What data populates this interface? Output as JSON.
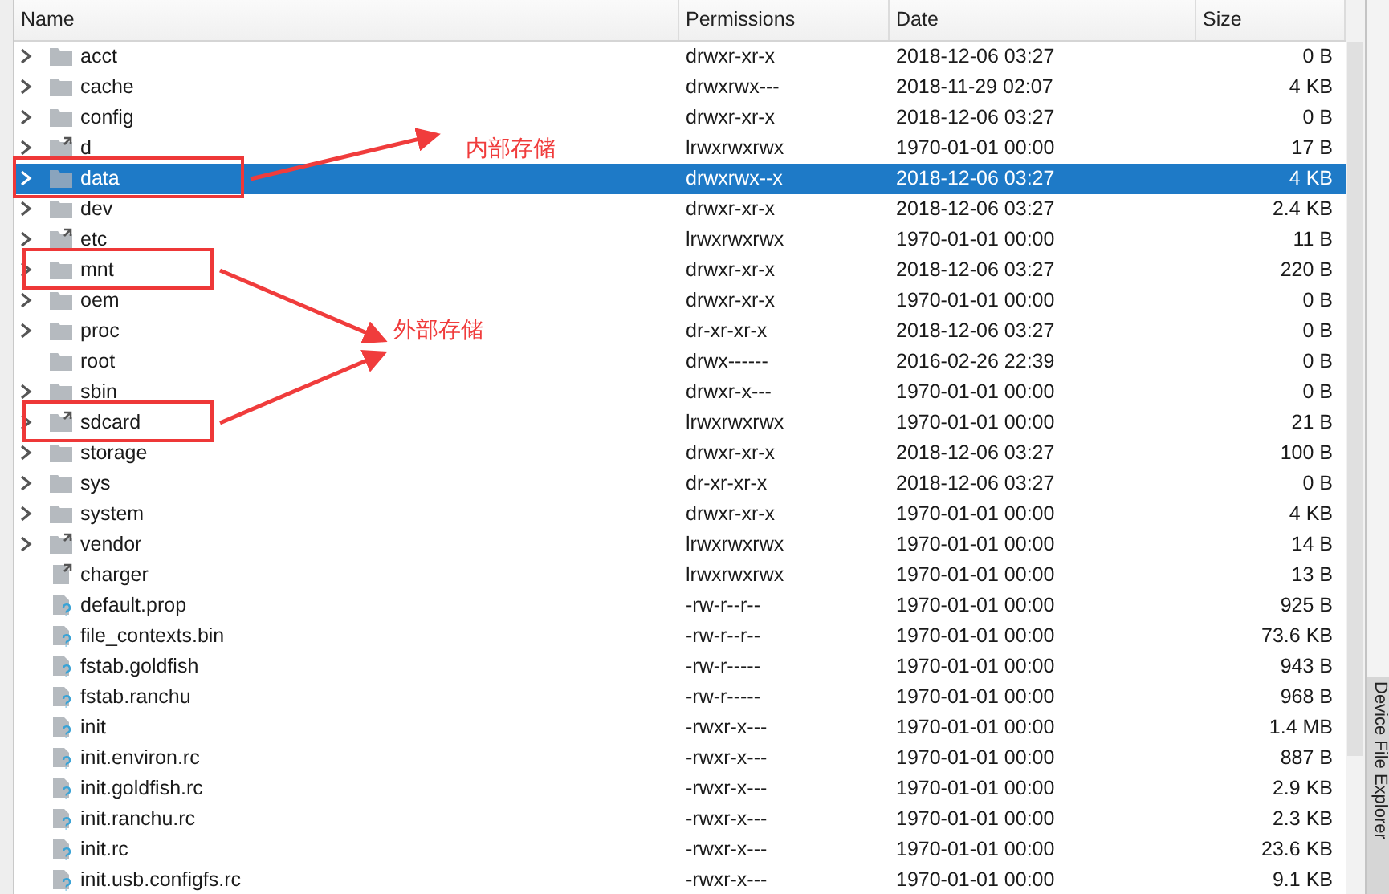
{
  "columns": [
    "Name",
    "Permissions",
    "Date",
    "Size"
  ],
  "rows": [
    {
      "name": "acct",
      "kind": "folder",
      "expandable": true,
      "selected": false,
      "permissions": "drwxr-xr-x",
      "date": "2018-12-06 03:27",
      "size": "0 B"
    },
    {
      "name": "cache",
      "kind": "folder",
      "expandable": true,
      "selected": false,
      "permissions": "drwxrwx---",
      "date": "2018-11-29 02:07",
      "size": "4 KB"
    },
    {
      "name": "config",
      "kind": "folder",
      "expandable": true,
      "selected": false,
      "permissions": "drwxr-xr-x",
      "date": "2018-12-06 03:27",
      "size": "0 B"
    },
    {
      "name": "d",
      "kind": "link-folder",
      "expandable": true,
      "selected": false,
      "permissions": "lrwxrwxrwx",
      "date": "1970-01-01 00:00",
      "size": "17 B"
    },
    {
      "name": "data",
      "kind": "folder",
      "expandable": true,
      "selected": true,
      "boxed": true,
      "permissions": "drwxrwx--x",
      "date": "2018-12-06 03:27",
      "size": "4 KB"
    },
    {
      "name": "dev",
      "kind": "folder",
      "expandable": true,
      "selected": false,
      "permissions": "drwxr-xr-x",
      "date": "2018-12-06 03:27",
      "size": "2.4 KB"
    },
    {
      "name": "etc",
      "kind": "link-folder",
      "expandable": true,
      "selected": false,
      "permissions": "lrwxrwxrwx",
      "date": "1970-01-01 00:00",
      "size": "11 B"
    },
    {
      "name": "mnt",
      "kind": "folder",
      "expandable": true,
      "selected": false,
      "boxed": true,
      "permissions": "drwxr-xr-x",
      "date": "2018-12-06 03:27",
      "size": "220 B"
    },
    {
      "name": "oem",
      "kind": "folder",
      "expandable": true,
      "selected": false,
      "permissions": "drwxr-xr-x",
      "date": "1970-01-01 00:00",
      "size": "0 B"
    },
    {
      "name": "proc",
      "kind": "folder",
      "expandable": true,
      "selected": false,
      "permissions": "dr-xr-xr-x",
      "date": "2018-12-06 03:27",
      "size": "0 B"
    },
    {
      "name": "root",
      "kind": "folder",
      "expandable": false,
      "selected": false,
      "permissions": "drwx------",
      "date": "2016-02-26 22:39",
      "size": "0 B"
    },
    {
      "name": "sbin",
      "kind": "folder",
      "expandable": true,
      "selected": false,
      "permissions": "drwxr-x---",
      "date": "1970-01-01 00:00",
      "size": "0 B"
    },
    {
      "name": "sdcard",
      "kind": "link-folder",
      "expandable": true,
      "selected": false,
      "boxed": true,
      "permissions": "lrwxrwxrwx",
      "date": "1970-01-01 00:00",
      "size": "21 B"
    },
    {
      "name": "storage",
      "kind": "folder",
      "expandable": true,
      "selected": false,
      "permissions": "drwxr-xr-x",
      "date": "2018-12-06 03:27",
      "size": "100 B"
    },
    {
      "name": "sys",
      "kind": "folder",
      "expandable": true,
      "selected": false,
      "permissions": "dr-xr-xr-x",
      "date": "2018-12-06 03:27",
      "size": "0 B"
    },
    {
      "name": "system",
      "kind": "folder",
      "expandable": true,
      "selected": false,
      "permissions": "drwxr-xr-x",
      "date": "1970-01-01 00:00",
      "size": "4 KB"
    },
    {
      "name": "vendor",
      "kind": "link-folder",
      "expandable": true,
      "selected": false,
      "permissions": "lrwxrwxrwx",
      "date": "1970-01-01 00:00",
      "size": "14 B"
    },
    {
      "name": "charger",
      "kind": "link-file",
      "expandable": false,
      "selected": false,
      "permissions": "lrwxrwxrwx",
      "date": "1970-01-01 00:00",
      "size": "13 B"
    },
    {
      "name": "default.prop",
      "kind": "file",
      "expandable": false,
      "selected": false,
      "permissions": "-rw-r--r--",
      "date": "1970-01-01 00:00",
      "size": "925 B"
    },
    {
      "name": "file_contexts.bin",
      "kind": "file",
      "expandable": false,
      "selected": false,
      "permissions": "-rw-r--r--",
      "date": "1970-01-01 00:00",
      "size": "73.6 KB"
    },
    {
      "name": "fstab.goldfish",
      "kind": "file",
      "expandable": false,
      "selected": false,
      "permissions": "-rw-r-----",
      "date": "1970-01-01 00:00",
      "size": "943 B"
    },
    {
      "name": "fstab.ranchu",
      "kind": "file",
      "expandable": false,
      "selected": false,
      "permissions": "-rw-r-----",
      "date": "1970-01-01 00:00",
      "size": "968 B"
    },
    {
      "name": "init",
      "kind": "file",
      "expandable": false,
      "selected": false,
      "permissions": "-rwxr-x---",
      "date": "1970-01-01 00:00",
      "size": "1.4 MB"
    },
    {
      "name": "init.environ.rc",
      "kind": "file",
      "expandable": false,
      "selected": false,
      "permissions": "-rwxr-x---",
      "date": "1970-01-01 00:00",
      "size": "887 B"
    },
    {
      "name": "init.goldfish.rc",
      "kind": "file",
      "expandable": false,
      "selected": false,
      "permissions": "-rwxr-x---",
      "date": "1970-01-01 00:00",
      "size": "2.9 KB"
    },
    {
      "name": "init.ranchu.rc",
      "kind": "file",
      "expandable": false,
      "selected": false,
      "permissions": "-rwxr-x---",
      "date": "1970-01-01 00:00",
      "size": "2.3 KB"
    },
    {
      "name": "init.rc",
      "kind": "file",
      "expandable": false,
      "selected": false,
      "permissions": "-rwxr-x---",
      "date": "1970-01-01 00:00",
      "size": "23.6 KB"
    },
    {
      "name": "init.usb.configfs.rc",
      "kind": "file",
      "expandable": false,
      "selected": false,
      "permissions": "-rwxr-x---",
      "date": "1970-01-01 00:00",
      "size": "9.1 KB"
    }
  ],
  "annotations": [
    {
      "label": "内部存储"
    },
    {
      "label": "外部存储"
    }
  ],
  "side_tab": "Device File Explorer"
}
